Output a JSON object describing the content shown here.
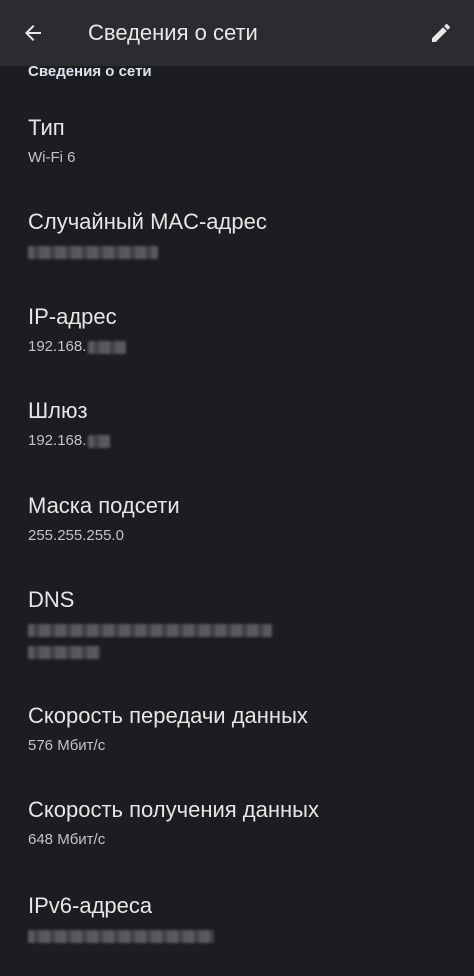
{
  "appbar": {
    "title": "Сведения о сети",
    "back_icon": "arrow-back-icon",
    "edit_icon": "pencil-icon"
  },
  "section": {
    "header": "Сведения о сети"
  },
  "items": [
    {
      "title": "Тип",
      "value": "Wi-Fi 6"
    },
    {
      "title": "Случайный MAC-адрес",
      "value": ""
    },
    {
      "title": "IP-адрес",
      "value": "192.168."
    },
    {
      "title": "Шлюз",
      "value": "192.168."
    },
    {
      "title": "Маска подсети",
      "value": "255.255.255.0"
    },
    {
      "title": "DNS",
      "value": ""
    },
    {
      "title": "Скорость передачи данных",
      "value": "576 Мбит/с"
    },
    {
      "title": "Скорость получения данных",
      "value": "648 Мбит/с"
    },
    {
      "title": "IPv6-адреса",
      "value": ""
    }
  ],
  "colors": {
    "appbar_bg": "#2b2c30",
    "page_bg": "#1c1d21",
    "header_text": "#dfe3f0"
  }
}
